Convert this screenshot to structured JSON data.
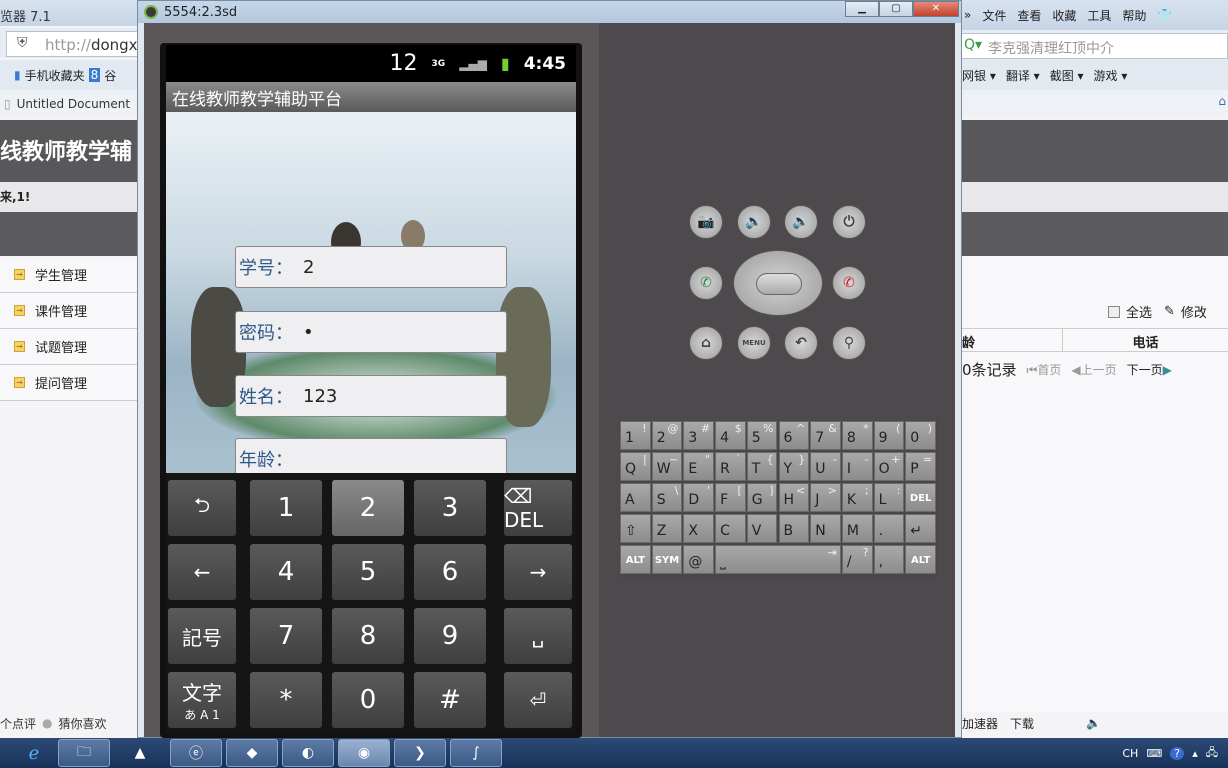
{
  "left_browser": {
    "title": "览器 7.1",
    "address": {
      "scheme": "http://",
      "host": "dongx"
    },
    "favorites": [
      "手机收藏夹",
      "谷"
    ],
    "tab": "Untitled Document",
    "page_header": "线教师教学辅",
    "welcome": "来,1!",
    "menu": [
      "学生管理",
      "课件管理",
      "试题管理",
      "提问管理"
    ],
    "status": [
      "个点评",
      "猜你喜欢"
    ]
  },
  "right_browser": {
    "menu": [
      "»",
      "文件",
      "查看",
      "收藏",
      "工具",
      "帮助"
    ],
    "search_placeholder": "李克强清理红顶中介",
    "toolbar": [
      "网银 ▾",
      "翻译 ▾",
      "截图 ▾",
      "游戏 ▾"
    ],
    "actions": {
      "select_all": "全选",
      "edit": "修改"
    },
    "table_headers": [
      "龄",
      "电话"
    ],
    "records": "0条记录",
    "pager": {
      "first": "首页",
      "prev": "上一页",
      "next": "下一页"
    },
    "status": [
      "加速器",
      "下载"
    ]
  },
  "emulator": {
    "title": "5554:2.3sd",
    "status_bar": {
      "notification": "12",
      "network": "3G",
      "time": "4:45",
      "battery": "charging"
    },
    "app_title": "在线教师教学辅助平台",
    "form": [
      {
        "label": "学号：",
        "value": "2"
      },
      {
        "label": "密码：",
        "value": "•"
      },
      {
        "label": "姓名：",
        "value": "123"
      },
      {
        "label": "年龄：",
        "value": ""
      }
    ],
    "ime_keys": [
      [
        "⮌",
        "1",
        "2",
        "3",
        "⌫ DEL"
      ],
      [
        "←",
        "4",
        "5",
        "6",
        "→"
      ],
      [
        "記号",
        "7",
        "8",
        "9",
        "␣"
      ],
      [
        "文字",
        "*",
        "0",
        "#",
        "⏎"
      ]
    ],
    "ime_mode_sub": "あ A 1",
    "pressed_key": "2",
    "hw_buttons": [
      "camera",
      "volume-down",
      "volume-up",
      "power",
      "call",
      "dpad",
      "end-call",
      "home",
      "MENU",
      "back",
      "search"
    ],
    "qwerty": [
      [
        [
          "1",
          "!"
        ],
        [
          "2",
          "@"
        ],
        [
          "3",
          "#"
        ],
        [
          "4",
          "$"
        ],
        [
          "5",
          "%"
        ],
        [
          "6",
          "^"
        ],
        [
          "7",
          "&"
        ],
        [
          "8",
          "*"
        ],
        [
          "9",
          "("
        ],
        [
          "0",
          ")"
        ]
      ],
      [
        [
          "Q",
          "|"
        ],
        [
          "W",
          "~"
        ],
        [
          "E",
          "\""
        ],
        [
          "R",
          "`"
        ],
        [
          "T",
          "{"
        ],
        [
          "Y",
          "}"
        ],
        [
          "U",
          "-"
        ],
        [
          "I",
          "-"
        ],
        [
          "O",
          "+"
        ],
        [
          "P",
          "="
        ]
      ],
      [
        [
          "A",
          ""
        ],
        [
          "S",
          "\\"
        ],
        [
          "D",
          "'"
        ],
        [
          "F",
          "["
        ],
        [
          "G",
          "]"
        ],
        [
          "H",
          "<"
        ],
        [
          "J",
          ">"
        ],
        [
          "K",
          ";"
        ],
        [
          "L",
          ":"
        ],
        [
          "DEL",
          ""
        ]
      ],
      [
        [
          "⇧",
          ""
        ],
        [
          "Z",
          ""
        ],
        [
          "X",
          ""
        ],
        [
          "C",
          ""
        ],
        [
          "V",
          ""
        ],
        [
          "B",
          ""
        ],
        [
          "N",
          ""
        ],
        [
          "M",
          ""
        ],
        [
          ".",
          ""
        ],
        [
          "↵",
          ""
        ]
      ],
      [
        [
          "ALT",
          ""
        ],
        [
          "SYM",
          ""
        ],
        [
          "@",
          ""
        ],
        [
          "⎵",
          "⇥"
        ],
        [
          "/",
          "?"
        ],
        [
          ",",
          ""
        ],
        [
          "ALT",
          ""
        ]
      ]
    ]
  },
  "taskbar": {
    "tray": [
      "CH",
      "?"
    ]
  }
}
